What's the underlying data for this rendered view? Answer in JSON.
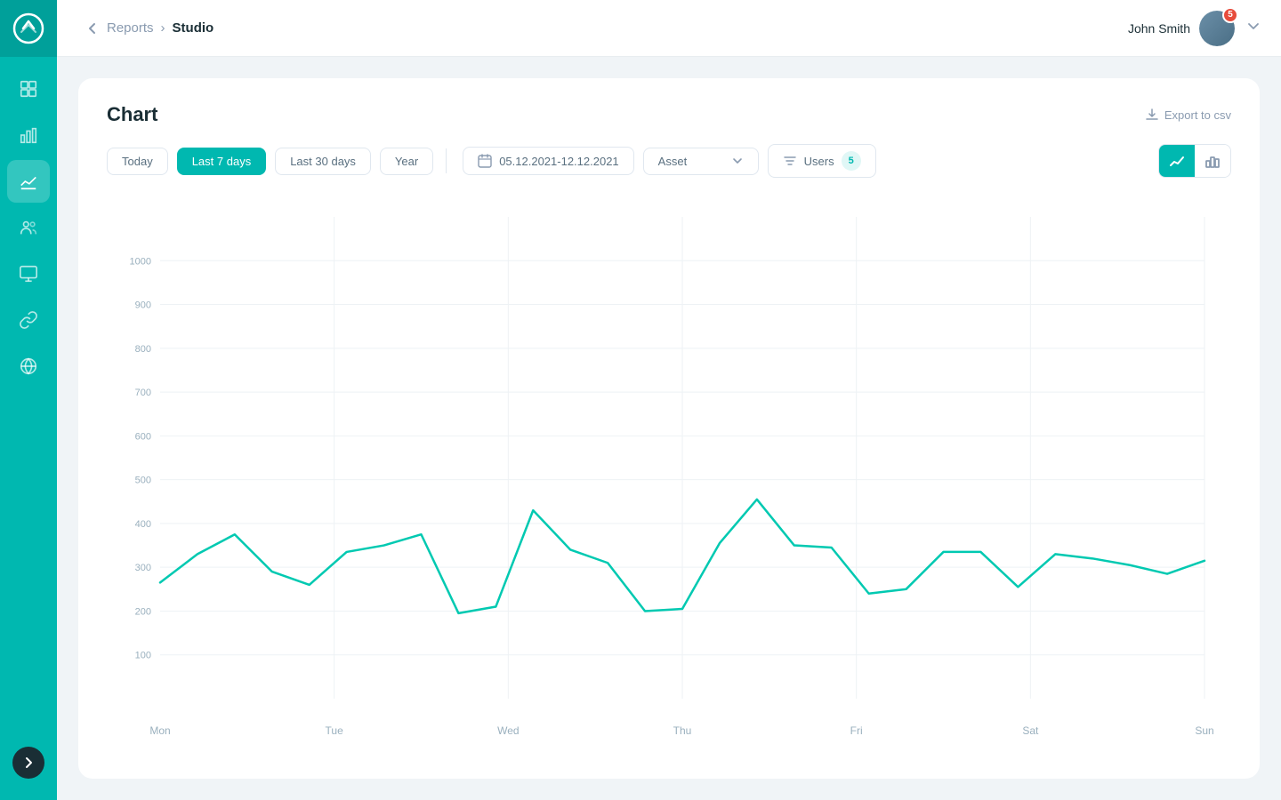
{
  "sidebar": {
    "items": [
      {
        "name": "dashboard",
        "icon": "grid"
      },
      {
        "name": "reports",
        "icon": "chart-bar"
      },
      {
        "name": "analytics",
        "icon": "line-chart",
        "active": true
      },
      {
        "name": "users",
        "icon": "users"
      },
      {
        "name": "presentations",
        "icon": "presentation"
      },
      {
        "name": "connections",
        "icon": "link"
      },
      {
        "name": "globe",
        "icon": "globe"
      }
    ]
  },
  "topbar": {
    "back_label": "←",
    "breadcrumb_parent": "Reports",
    "breadcrumb_separator": ">",
    "breadcrumb_current": "Studio",
    "username": "John Smith",
    "badge_count": "5"
  },
  "card": {
    "title": "Chart",
    "export_label": "Export to csv"
  },
  "filters": {
    "today": "Today",
    "last7": "Last 7 days",
    "last30": "Last 30 days",
    "year": "Year",
    "date_range": "05.12.2021-12.12.2021",
    "asset_label": "Asset",
    "users_label": "Users",
    "users_count": "5"
  },
  "chart": {
    "y_labels": [
      "100",
      "200",
      "300",
      "400",
      "500",
      "600",
      "700",
      "800",
      "900",
      "1000"
    ],
    "x_labels": [
      "Mon",
      "Tue",
      "Wed",
      "Thu",
      "Fri",
      "Sat",
      "Sun"
    ],
    "line_color": "#00c9b1",
    "data_points": [
      265,
      330,
      375,
      290,
      260,
      335,
      350,
      375,
      195,
      210,
      430,
      340,
      310,
      200,
      205,
      355,
      455,
      350,
      345,
      240,
      250,
      335,
      335,
      255,
      330,
      320,
      305,
      285,
      315
    ]
  }
}
